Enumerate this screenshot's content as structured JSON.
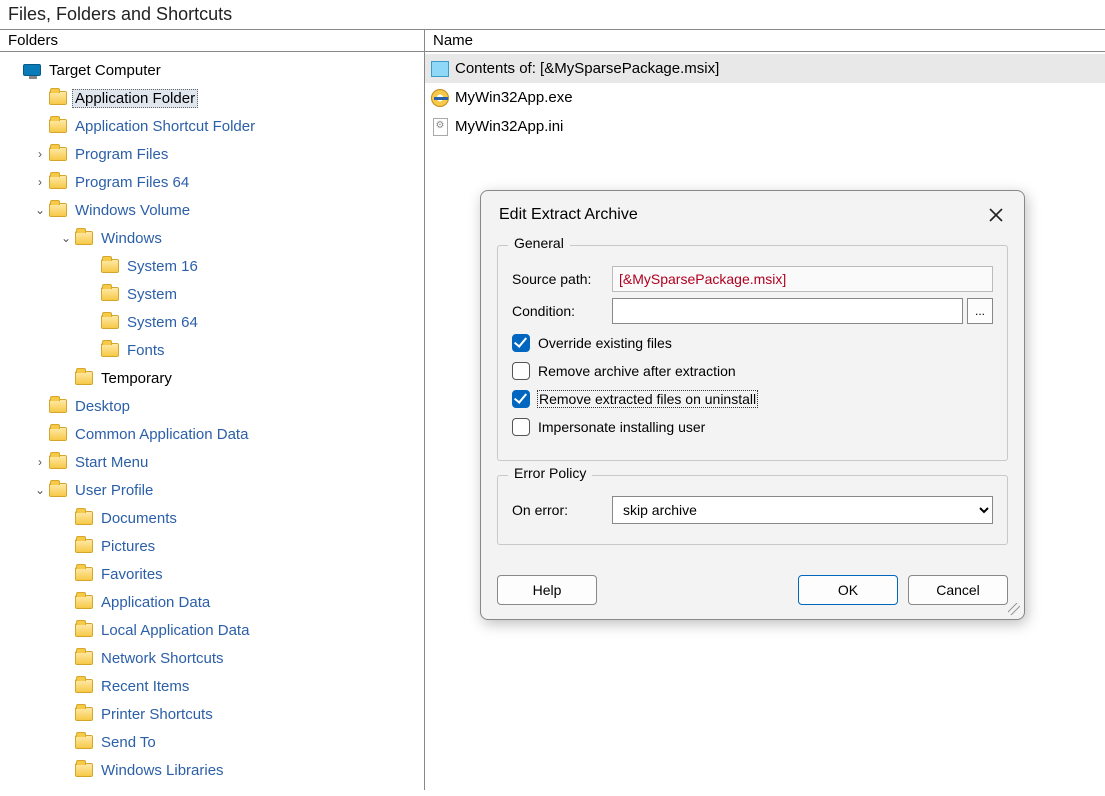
{
  "window": {
    "title": "Files, Folders and Shortcuts",
    "left_header": "Folders",
    "right_header": "Name"
  },
  "tree": [
    {
      "depth": 0,
      "exp": "none",
      "icon": "monitor",
      "label": "Target Computer",
      "link": false
    },
    {
      "depth": 1,
      "exp": "none",
      "icon": "folder",
      "label": "Application Folder",
      "link": false,
      "selected": true
    },
    {
      "depth": 1,
      "exp": "none",
      "icon": "folder",
      "label": "Application Shortcut Folder",
      "link": true
    },
    {
      "depth": 1,
      "exp": "closed",
      "icon": "folder",
      "label": "Program Files",
      "link": true
    },
    {
      "depth": 1,
      "exp": "closed",
      "icon": "folder",
      "label": "Program Files 64",
      "link": true
    },
    {
      "depth": 1,
      "exp": "open",
      "icon": "folder",
      "label": "Windows Volume",
      "link": true
    },
    {
      "depth": 2,
      "exp": "open",
      "icon": "folder",
      "label": "Windows",
      "link": true
    },
    {
      "depth": 3,
      "exp": "none",
      "icon": "folder",
      "label": "System 16",
      "link": true
    },
    {
      "depth": 3,
      "exp": "none",
      "icon": "folder",
      "label": "System",
      "link": true
    },
    {
      "depth": 3,
      "exp": "none",
      "icon": "folder",
      "label": "System 64",
      "link": true
    },
    {
      "depth": 3,
      "exp": "none",
      "icon": "folder",
      "label": "Fonts",
      "link": true
    },
    {
      "depth": 2,
      "exp": "none",
      "icon": "folder",
      "label": "Temporary",
      "link": false
    },
    {
      "depth": 1,
      "exp": "none",
      "icon": "folder",
      "label": "Desktop",
      "link": true
    },
    {
      "depth": 1,
      "exp": "none",
      "icon": "folder",
      "label": "Common Application Data",
      "link": true
    },
    {
      "depth": 1,
      "exp": "closed",
      "icon": "folder",
      "label": "Start Menu",
      "link": true
    },
    {
      "depth": 1,
      "exp": "open",
      "icon": "folder",
      "label": "User Profile",
      "link": true
    },
    {
      "depth": 2,
      "exp": "none",
      "icon": "folder",
      "label": "Documents",
      "link": true
    },
    {
      "depth": 2,
      "exp": "none",
      "icon": "folder",
      "label": "Pictures",
      "link": true
    },
    {
      "depth": 2,
      "exp": "none",
      "icon": "folder",
      "label": "Favorites",
      "link": true
    },
    {
      "depth": 2,
      "exp": "none",
      "icon": "folder",
      "label": "Application Data",
      "link": true
    },
    {
      "depth": 2,
      "exp": "none",
      "icon": "folder",
      "label": "Local Application Data",
      "link": true
    },
    {
      "depth": 2,
      "exp": "none",
      "icon": "folder",
      "label": "Network Shortcuts",
      "link": true
    },
    {
      "depth": 2,
      "exp": "none",
      "icon": "folder",
      "label": "Recent Items",
      "link": true
    },
    {
      "depth": 2,
      "exp": "none",
      "icon": "folder",
      "label": "Printer Shortcuts",
      "link": true
    },
    {
      "depth": 2,
      "exp": "none",
      "icon": "folder",
      "label": "Send To",
      "link": true
    },
    {
      "depth": 2,
      "exp": "none",
      "icon": "folder",
      "label": "Windows Libraries",
      "link": true
    }
  ],
  "files": [
    {
      "icon": "box",
      "name": "Contents of: [&MySparsePackage.msix]",
      "selected": true
    },
    {
      "icon": "exe",
      "name": "MyWin32App.exe",
      "selected": false
    },
    {
      "icon": "ini",
      "name": "MyWin32App.ini",
      "selected": false
    }
  ],
  "dialog": {
    "title": "Edit Extract Archive",
    "group_general": "General",
    "group_error": "Error Policy",
    "source_label": "Source path:",
    "source_value": "[&MySparsePackage.msix]",
    "condition_label": "Condition:",
    "condition_value": "",
    "browse_label": "...",
    "chk_override": "Override existing files",
    "chk_remove_archive": "Remove archive after extraction",
    "chk_remove_uninstall": "Remove extracted files on uninstall",
    "chk_impersonate": "Impersonate installing user",
    "onerror_label": "On error:",
    "onerror_value": "skip archive",
    "btn_help": "Help",
    "btn_ok": "OK",
    "btn_cancel": "Cancel"
  }
}
